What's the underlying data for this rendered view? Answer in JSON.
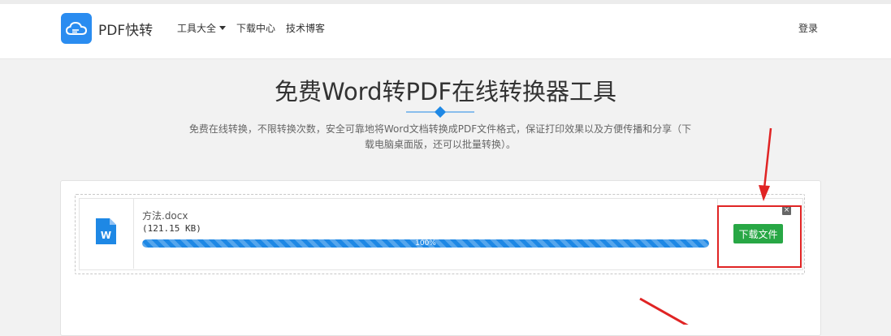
{
  "header": {
    "brand": "PDF快转",
    "nav": {
      "tools": "工具大全",
      "download_center": "下载中心",
      "tech_blog": "技术博客"
    },
    "login": "登录"
  },
  "main": {
    "title": "免费Word转PDF在线转换器工具",
    "subtitle": "免费在线转换，不限转换次数，安全可靠地将Word文档转换成PDF文件格式，保证打印效果以及方便传播和分享（下载电脑桌面版，还可以批量转换）。"
  },
  "file": {
    "name": "方法.docx",
    "size": "(121.15 KB)",
    "progress": 100,
    "progress_label": "100%",
    "download_label": "下载文件",
    "close_symbol": "×",
    "icon": "word-file-icon"
  },
  "colors": {
    "brand_blue": "#2a8cf0",
    "progress_blue": "#1e88e5",
    "download_green": "#28a745",
    "annotation_red": "#e02424"
  }
}
